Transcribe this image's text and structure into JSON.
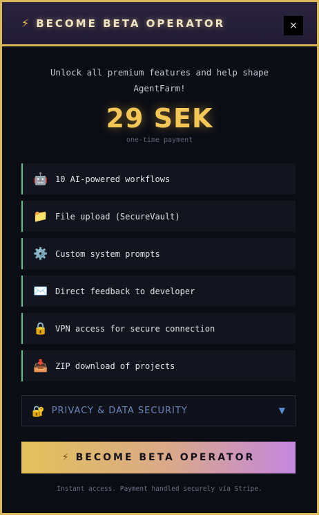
{
  "header": {
    "bolt_icon": "⚡",
    "title": "BECOME BETA OPERATOR",
    "close_label": "×"
  },
  "intro": {
    "text": "Unlock all premium features and help shape AgentFarm!"
  },
  "price": {
    "amount": "29 SEK",
    "note": "one-time payment"
  },
  "features": [
    {
      "icon": "🤖",
      "icon_name": "robot-icon",
      "label": "10 AI-powered workflows"
    },
    {
      "icon": "📁",
      "icon_name": "folder-icon",
      "label": "File upload (SecureVault)"
    },
    {
      "icon": "⚙️",
      "icon_name": "gear-icon",
      "label": "Custom system prompts"
    },
    {
      "icon": "✉️",
      "icon_name": "envelope-icon",
      "label": "Direct feedback to developer"
    },
    {
      "icon": "🔒",
      "icon_name": "lock-icon",
      "label": "VPN access for secure connection"
    },
    {
      "icon": "📥",
      "icon_name": "inbox-tray-icon",
      "label": "ZIP download of projects"
    }
  ],
  "privacy": {
    "icon": "🔐",
    "label": "PRIVACY & DATA SECURITY",
    "chevron": "▼"
  },
  "cta": {
    "bolt_icon": "⚡",
    "label": "BECOME BETA OPERATOR"
  },
  "footnote": "Instant access. Payment handled securely via Stripe.",
  "colors": {
    "gold": "#d9b75a",
    "price": "#f4c656",
    "feature_accent": "#57c28e",
    "privacy_text": "#6b86b8",
    "cta_gradient_start": "#e3c25a",
    "cta_gradient_end": "#c387e0"
  }
}
